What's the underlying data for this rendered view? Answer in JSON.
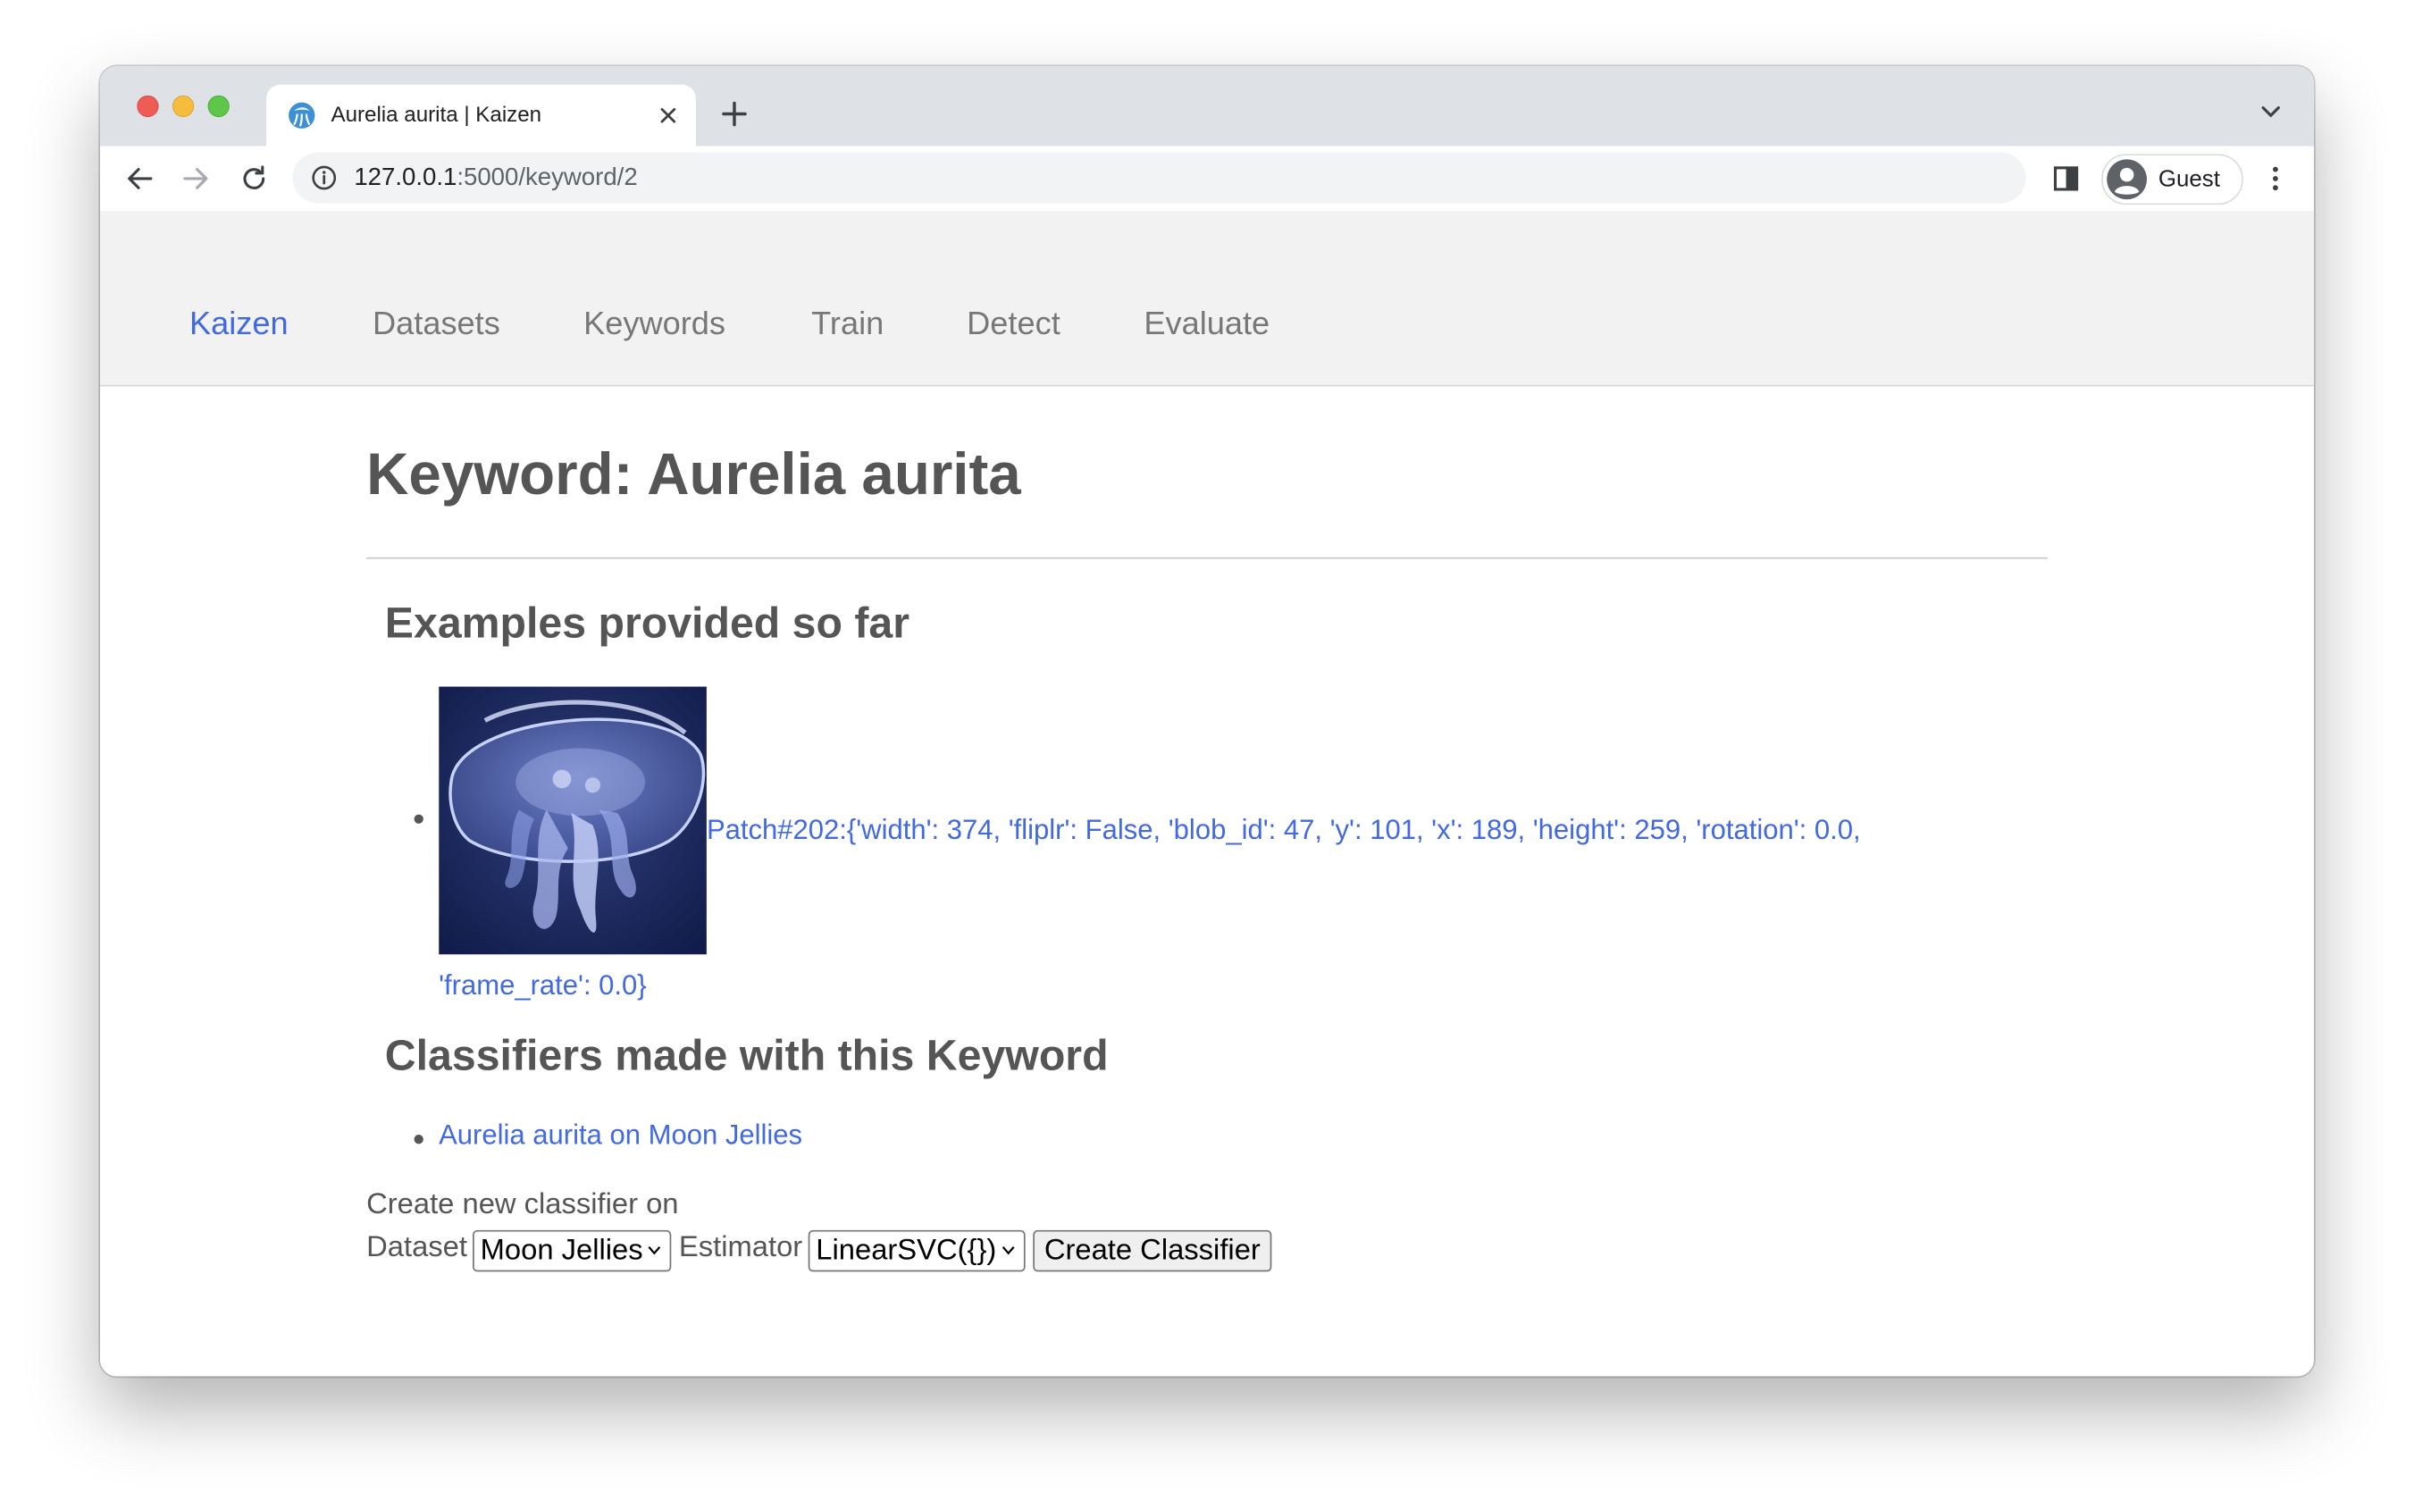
{
  "browser": {
    "tab": {
      "title": "Aurelia aurita | Kaizen",
      "favicon": "jellyfish-favicon-icon"
    },
    "url": {
      "host": "127.0.0.1",
      "path": ":5000/keyword/2"
    },
    "profile": {
      "label": "Guest"
    }
  },
  "navbar": {
    "brand": "Kaizen",
    "links": [
      "Datasets",
      "Keywords",
      "Train",
      "Detect",
      "Evaluate"
    ]
  },
  "page": {
    "title": "Keyword: Aurelia aurita",
    "examples": {
      "heading": "Examples provided so far",
      "items": [
        {
          "line1": "Patch#202:{'width': 374, 'fliplr': False, 'blob_id': 47, 'y': 101, 'x': 189, 'height': 259, 'rotation': 0.0,",
          "line2": "'frame_rate': 0.0}"
        }
      ]
    },
    "classifiers": {
      "heading": "Classifiers made with this Keyword",
      "items": [
        "Aurelia aurita on Moon Jellies"
      ]
    },
    "create_form": {
      "intro": "Create new classifier on",
      "dataset_label": "Dataset",
      "dataset_selected": "Moon Jellies",
      "estimator_label": "Estimator",
      "estimator_selected": "LinearSVC({})",
      "submit_label": "Create Classifier"
    }
  },
  "colors": {
    "link": "#4169e1",
    "text": "#555555",
    "navbar_bg": "#f2f2f2",
    "tabstrip_bg": "#dee1e6"
  }
}
